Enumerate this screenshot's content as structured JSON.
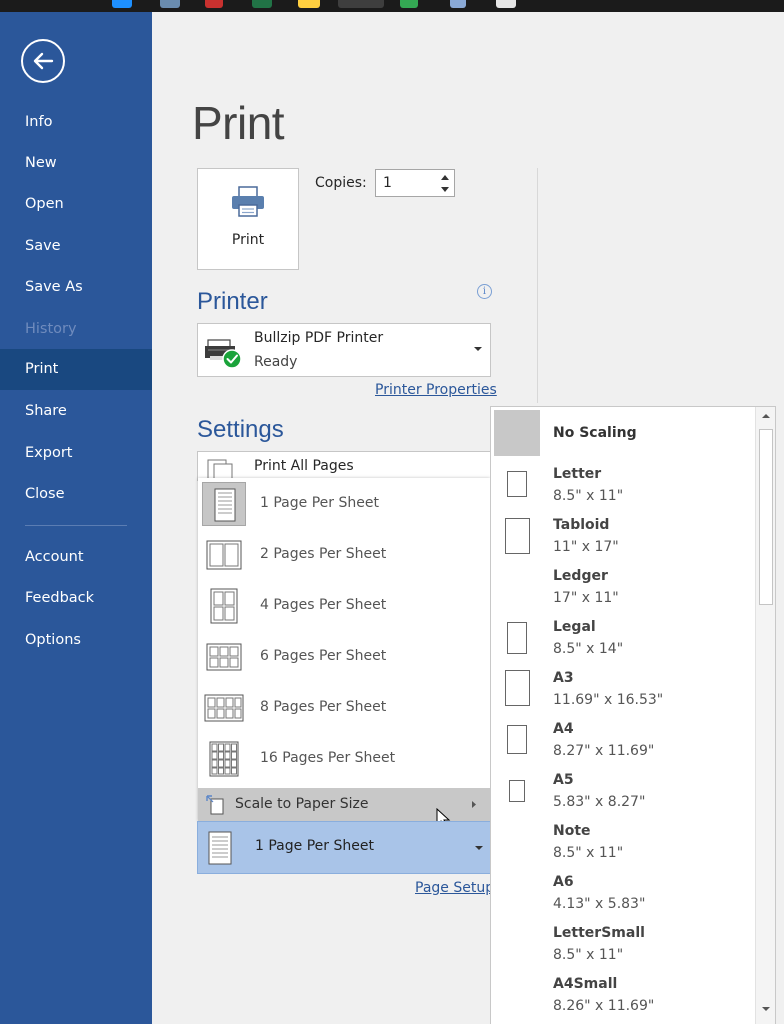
{
  "sidebar": {
    "items": [
      {
        "label": "Info"
      },
      {
        "label": "New"
      },
      {
        "label": "Open"
      },
      {
        "label": "Save"
      },
      {
        "label": "Save As"
      },
      {
        "label": "History",
        "disabled": true
      },
      {
        "label": "Print",
        "active": true
      },
      {
        "label": "Share"
      },
      {
        "label": "Export"
      },
      {
        "label": "Close"
      },
      {
        "label": "Account"
      },
      {
        "label": "Feedback"
      },
      {
        "label": "Options"
      }
    ],
    "back_icon": "arrow-left-circle-icon"
  },
  "main": {
    "title": "Print",
    "print_button_label": "Print",
    "copies_label": "Copies:",
    "copies_value": "1",
    "printer_section_title": "Printer",
    "printer": {
      "name": "Bullzip PDF Printer",
      "status": "Ready"
    },
    "printer_properties_link": "Printer Properties",
    "settings_section_title": "Settings",
    "print_range_value": "Print All Pages",
    "pages_per_sheet_options": [
      {
        "label": "1 Page Per Sheet",
        "selected": true
      },
      {
        "label": "2 Pages Per Sheet"
      },
      {
        "label": "4 Pages Per Sheet"
      },
      {
        "label": "6 Pages Per Sheet"
      },
      {
        "label": "8 Pages Per Sheet"
      },
      {
        "label": "16 Pages Per Sheet"
      }
    ],
    "scale_to_paper_label": "Scale to Paper Size",
    "pages_per_sheet_value": "1 Page Per Sheet",
    "page_setup_link": "Page Setup"
  },
  "paper_sizes": [
    {
      "name": "No Scaling",
      "size": ""
    },
    {
      "name": "Letter",
      "size": "8.5\" x 11\""
    },
    {
      "name": "Tabloid",
      "size": "11\" x 17\""
    },
    {
      "name": "Ledger",
      "size": "17\" x 11\""
    },
    {
      "name": "Legal",
      "size": "8.5\" x 14\""
    },
    {
      "name": "A3",
      "size": "11.69\" x 16.53\""
    },
    {
      "name": "A4",
      "size": "8.27\" x 11.69\""
    },
    {
      "name": "A5",
      "size": "5.83\" x 8.27\""
    },
    {
      "name": "Note",
      "size": "8.5\" x 11\""
    },
    {
      "name": "A6",
      "size": "4.13\" x 5.83\""
    },
    {
      "name": "LetterSmall",
      "size": "8.5\" x 11\""
    },
    {
      "name": "A4Small",
      "size": "8.26\" x 11.69\""
    }
  ],
  "colors": {
    "sidebar": "#2b579a",
    "sidebar_active": "#194880",
    "accent": "#2b579a",
    "selected_dropdown": "#a9c4e8",
    "status_ok": "#1aa33a"
  }
}
